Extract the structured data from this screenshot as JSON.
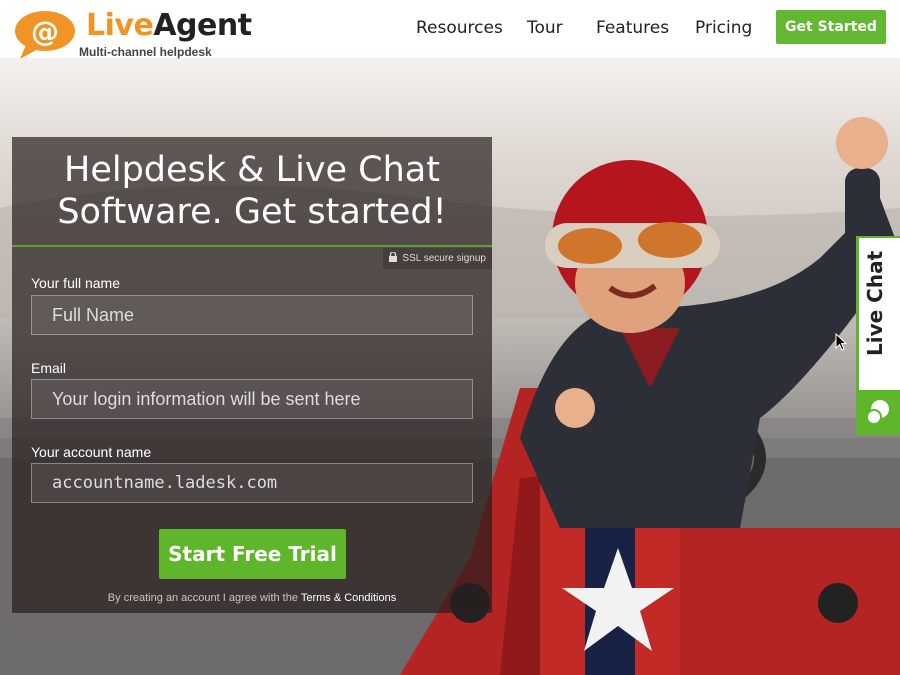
{
  "header": {
    "brand_live": "Live",
    "brand_agent": "Agent",
    "tagline": "Multi-channel helpdesk",
    "nav": {
      "resources": "Resources",
      "tour": "Tour",
      "features": "Features",
      "pricing": "Pricing"
    },
    "cta": "Get Started"
  },
  "form": {
    "title_line1": "Helpdesk & Live Chat",
    "title_line2": "Software. Get started!",
    "ssl_badge": "SSL secure signup",
    "full_name": {
      "label": "Your full name",
      "placeholder": "Full Name"
    },
    "email": {
      "label": "Email",
      "placeholder": "Your login information will be sent here"
    },
    "account": {
      "label": "Your account name",
      "placeholder": "accountname.ladesk.com"
    },
    "submit": "Start Free Trial",
    "terms_prefix": "By creating an account I agree with the",
    "terms_link": "Terms & Conditions"
  },
  "live_chat_tab": {
    "label": "Live Chat"
  },
  "colors": {
    "brand_orange": "#f19426",
    "accent_green": "#5fb62b",
    "panel_bg": "#261e1c"
  }
}
